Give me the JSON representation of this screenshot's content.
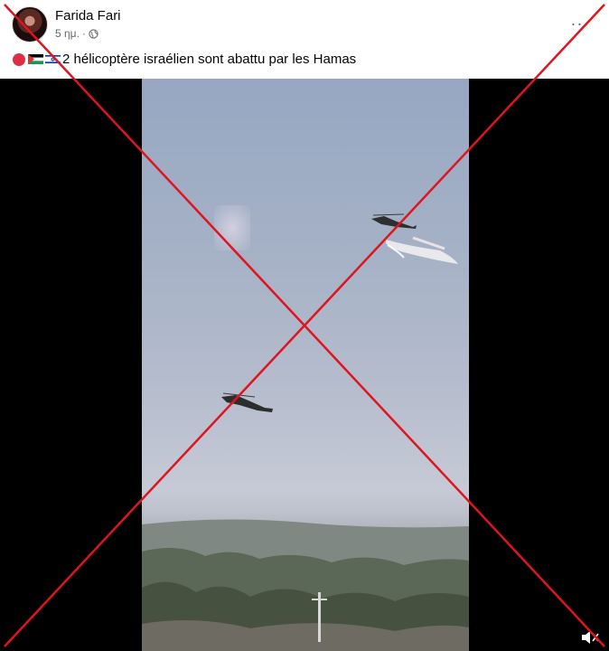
{
  "post": {
    "author": "Farida Fari",
    "time": "5 ημ.",
    "separator": "·",
    "caption": "2 hélicoptère israélien sont abattu par les Hamas",
    "more_label": "···"
  },
  "icons": {
    "globe": "globe-icon",
    "more": "more-options-icon",
    "red_circle": "red-circle-emoji",
    "palestine_flag": "palestine-flag-emoji",
    "israel_flag": "israel-flag-emoji",
    "volume": "volume-icon"
  },
  "colors": {
    "cross": "#e0141e",
    "meta_text": "#65676b",
    "video_bg": "#000000"
  }
}
